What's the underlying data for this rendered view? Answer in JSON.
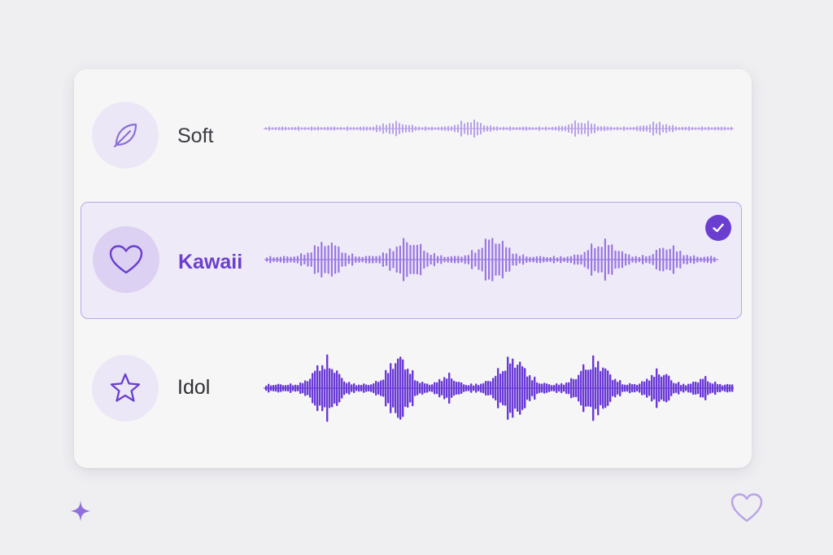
{
  "voices": [
    {
      "id": "soft",
      "label": "Soft",
      "icon": "leaf-icon",
      "selected": false
    },
    {
      "id": "kawaii",
      "label": "Kawaii",
      "icon": "heart-icon",
      "selected": true
    },
    {
      "id": "idol",
      "label": "Idol",
      "icon": "star-icon",
      "selected": false
    }
  ],
  "colors": {
    "accent": "#6a3fd0",
    "soft_wave": "#b9a2e8",
    "kawaii_wave": "#9a78e0",
    "idol_wave": "#6a3ad6",
    "icon_stroke": "#8b6fd8"
  },
  "decorations": [
    "sparkle-icon",
    "heart-outline-icon"
  ]
}
